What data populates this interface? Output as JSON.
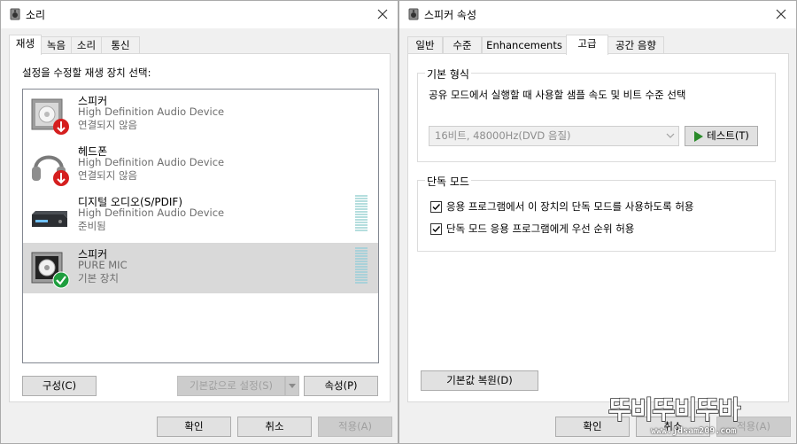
{
  "left_window": {
    "title": "소리",
    "tabs": [
      "재생",
      "녹음",
      "소리",
      "통신"
    ],
    "active_tab": 0,
    "instruction": "설정을 수정할 재생 장치 선택:",
    "devices": [
      {
        "name": "스피커",
        "description": "High Definition Audio Device",
        "status": "연결되지 않음",
        "icon": "speaker-icon",
        "badge": "red-down-arrow-badge"
      },
      {
        "name": "헤드폰",
        "description": "High Definition Audio Device",
        "status": "연결되지 않음",
        "icon": "headphones-icon",
        "badge": "red-down-arrow-badge"
      },
      {
        "name": "디지털 오디오(S/PDIF)",
        "description": "High Definition Audio Device",
        "status": "준비됨",
        "icon": "spdif-device-icon",
        "badge": ""
      },
      {
        "name": "스피커",
        "description": "PURE MIC",
        "status": "기본 장치",
        "icon": "speaker-icon",
        "badge": "green-check-badge",
        "selected": true
      }
    ],
    "buttons": {
      "configure": "구성(C)",
      "set_default": "기본값으로 설정(S)",
      "properties": "속성(P)",
      "ok": "확인",
      "cancel": "취소",
      "apply": "적용(A)"
    }
  },
  "right_window": {
    "title": "스피커 속성",
    "tabs": [
      "일반",
      "수준",
      "Enhancements",
      "고급",
      "공간 음향"
    ],
    "active_tab": 3,
    "default_format": {
      "title": "기본 형식",
      "description": "공유 모드에서 실행할 때 사용할 샘플 속도 및 비트 수준 선택",
      "selected": "16비트, 48000Hz(DVD 음질)",
      "test_button": "테스트(T)"
    },
    "exclusive_mode": {
      "title": "단독 모드",
      "options": [
        {
          "label": "응용 프로그램에서 이 장치의 단독 모드를 사용하도록 허용",
          "checked": true
        },
        {
          "label": "단독 모드 응용 프로그램에게 우선 순위 허용",
          "checked": true
        }
      ]
    },
    "restore_defaults": "기본값 복원(D)",
    "buttons": {
      "ok": "확인",
      "cancel": "취소",
      "apply": "적용(A)"
    }
  },
  "watermark": {
    "logo_text": "뚜비뚜비뚜바",
    "url": "www.jdsam209.com"
  },
  "colors": {
    "window_bg": "#f0f0f0",
    "panel_bg": "#ffffff",
    "selected_row": "#d9d9d9",
    "secondary_text": "#6d6d6d",
    "disabled_text": "#a0a0a0",
    "test_arrow": "#2a8a2a",
    "meter": "#b5dede"
  }
}
